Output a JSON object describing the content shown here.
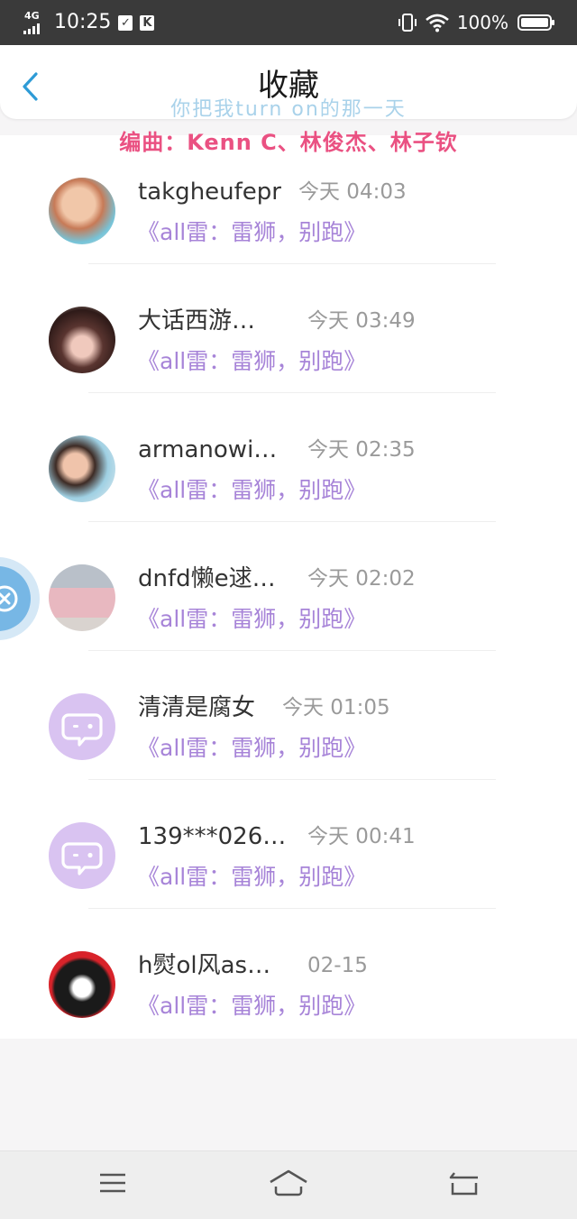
{
  "status_bar": {
    "network": "4G",
    "time": "10:25",
    "notification_icons": [
      "check-clipboard-icon",
      "k-app-icon"
    ],
    "k_glyph": "K",
    "battery_percent": "100%",
    "battery_level": 1.0
  },
  "header": {
    "title": "收藏",
    "back_icon": "chevron-left-icon",
    "accent_color": "#2e9bd6"
  },
  "overlay": {
    "line1": "你把我turn on的那一天",
    "line2": "编曲：Kenn C、林俊杰、林子钦"
  },
  "list": [
    {
      "name": "takgheufepr",
      "time": "今天 04:03",
      "link": "《all雷：雷狮，别跑》",
      "avatar": "photo"
    },
    {
      "name": "大话西游…",
      "time": "今天 03:49",
      "link": "《all雷：雷狮，别跑》",
      "avatar": "photo"
    },
    {
      "name": "armanowi…",
      "time": "今天 02:35",
      "link": "《all雷：雷狮，别跑》",
      "avatar": "photo"
    },
    {
      "name": "dnfd懒e逑…",
      "time": "今天 02:02",
      "link": "《all雷：雷狮，别跑》",
      "avatar": "photo"
    },
    {
      "name": "清清是腐女",
      "time": "今天 01:05",
      "link": "《all雷：雷狮，别跑》",
      "avatar": "default"
    },
    {
      "name": "139***026…",
      "time": "今天 00:41",
      "link": "《all雷：雷狮，别跑》",
      "avatar": "default"
    },
    {
      "name": "h熨ol风as…",
      "time": "02-15",
      "link": "《all雷：雷狮，别跑》",
      "avatar": "photo"
    }
  ],
  "floating_button_icon": "close-circle-icon",
  "nav_bar": {
    "icons": [
      "menu-icon",
      "home-icon",
      "back-icon"
    ]
  },
  "colors": {
    "link": "#a784d8",
    "overlay_blue": "#a9d2ea",
    "overlay_pink": "#ea5182",
    "default_avatar": "#d9c3f1"
  }
}
